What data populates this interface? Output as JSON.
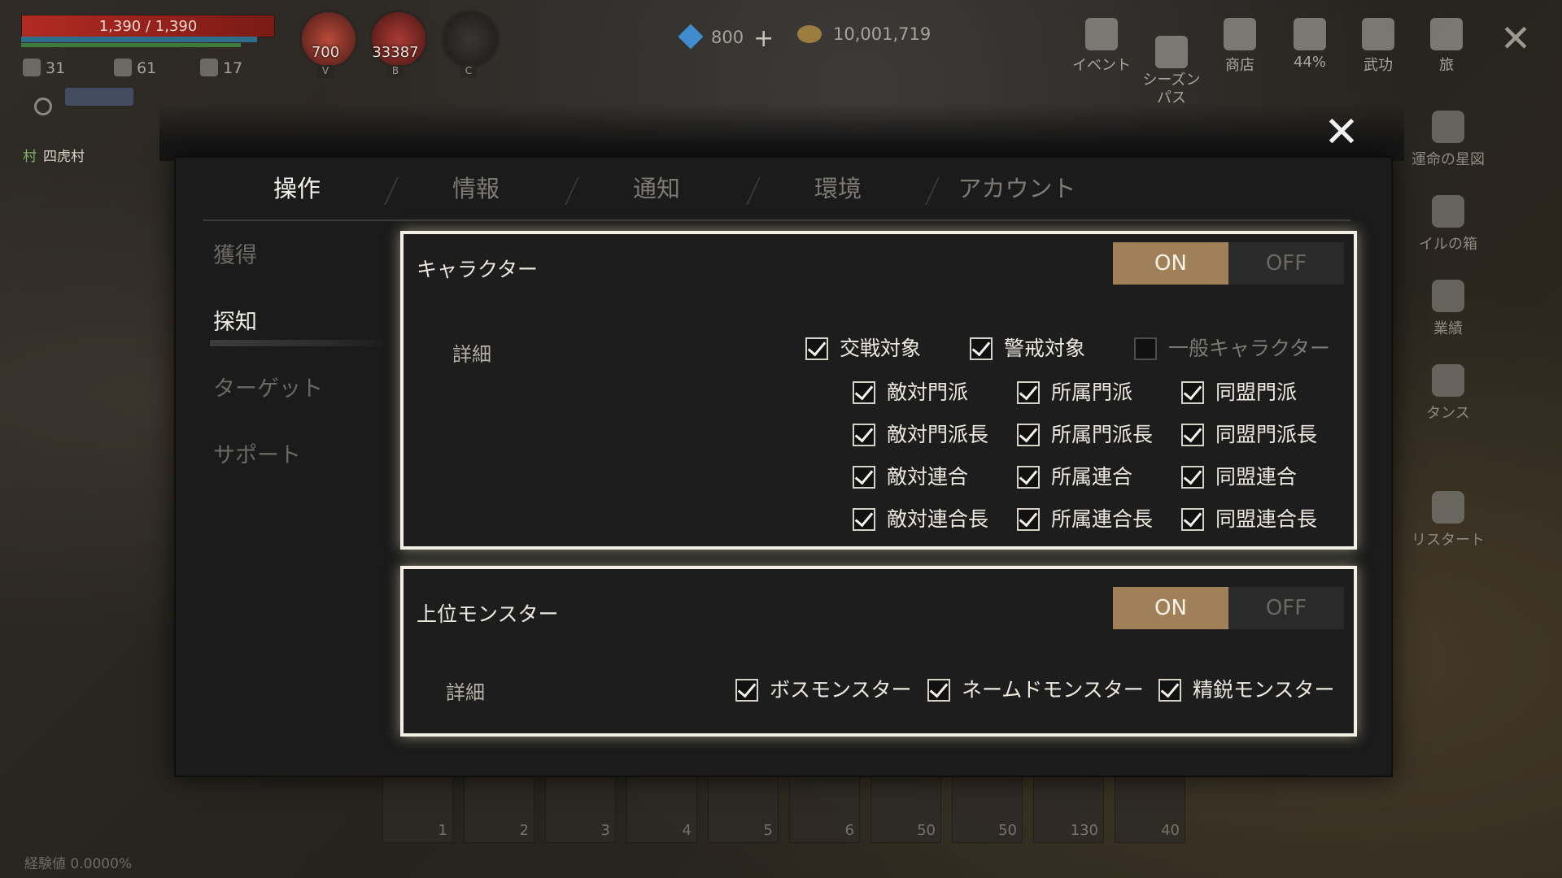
{
  "hud": {
    "hp_text": "1,390 / 1,390",
    "stats": [
      {
        "icon": "sword-icon",
        "value": "31"
      },
      {
        "icon": "shield-icon",
        "value": "61"
      },
      {
        "icon": "star-icon",
        "value": "17"
      }
    ],
    "orbs": [
      {
        "value": "700",
        "key": "V",
        "color": "#8a2a24"
      },
      {
        "value": "33387",
        "key": "B",
        "color": "#7a2420"
      },
      {
        "value": "",
        "key": "C",
        "color": "#2b2826"
      }
    ],
    "village_tag": "村",
    "village_name": "四虎村",
    "gems": "800",
    "gold": "10,001,719",
    "exp": "経験値 0.0000%"
  },
  "top_menu": [
    {
      "label": "イベント",
      "icon": "gift-icon"
    },
    {
      "label": "シーズン\nパス",
      "icon": "checklist-icon"
    },
    {
      "label": "商店",
      "icon": "shop-icon"
    },
    {
      "label": "44%",
      "icon": "lotus-icon"
    },
    {
      "label": "武功",
      "icon": "yin-yang-icon"
    },
    {
      "label": "旅",
      "icon": "journey-icon"
    }
  ],
  "side_menu": [
    {
      "label": "運命の星図",
      "icon": "spiral-icon"
    },
    {
      "label": "イルの箱",
      "icon": "box-icon"
    },
    {
      "label": "業績",
      "icon": "achievement-icon"
    },
    {
      "label": "タンス",
      "icon": "wardrobe-icon"
    },
    {
      "label": "リスタート",
      "icon": "restart-icon"
    }
  ],
  "hotbar": [
    {
      "num": "1"
    },
    {
      "num": "2"
    },
    {
      "num": "3"
    },
    {
      "num": "4"
    },
    {
      "num": "5"
    },
    {
      "num": "6"
    },
    {
      "num": "50"
    },
    {
      "num": "50"
    },
    {
      "num": "130"
    },
    {
      "num": "40"
    }
  ],
  "settings": {
    "tabs": [
      "操作",
      "情報",
      "通知",
      "環境",
      "アカウント"
    ],
    "active_tab": "操作",
    "side_tabs": [
      "獲得",
      "探知",
      "ターゲット",
      "サポート"
    ],
    "active_side_tab": "探知",
    "character": {
      "title": "キャラクター",
      "on": "ON",
      "off": "OFF",
      "state": "ON",
      "detail_label": "詳細",
      "top_row": [
        {
          "label": "交戦対象",
          "checked": true
        },
        {
          "label": "警戒対象",
          "checked": true
        },
        {
          "label": "一般キャラクター",
          "checked": false
        }
      ],
      "grid": [
        [
          {
            "label": "敵対門派",
            "checked": true
          },
          {
            "label": "所属門派",
            "checked": true
          },
          {
            "label": "同盟門派",
            "checked": true
          }
        ],
        [
          {
            "label": "敵対門派長",
            "checked": true
          },
          {
            "label": "所属門派長",
            "checked": true
          },
          {
            "label": "同盟門派長",
            "checked": true
          }
        ],
        [
          {
            "label": "敵対連合",
            "checked": true
          },
          {
            "label": "所属連合",
            "checked": true
          },
          {
            "label": "同盟連合",
            "checked": true
          }
        ],
        [
          {
            "label": "敵対連合長",
            "checked": true
          },
          {
            "label": "所属連合長",
            "checked": true
          },
          {
            "label": "同盟連合長",
            "checked": true
          }
        ]
      ]
    },
    "monster": {
      "title": "上位モンスター",
      "on": "ON",
      "off": "OFF",
      "state": "ON",
      "detail_label": "詳細",
      "options": [
        {
          "label": "ボスモンスター",
          "checked": true
        },
        {
          "label": "ネームドモンスター",
          "checked": true
        },
        {
          "label": "精鋭モンスター",
          "checked": true
        }
      ]
    }
  }
}
